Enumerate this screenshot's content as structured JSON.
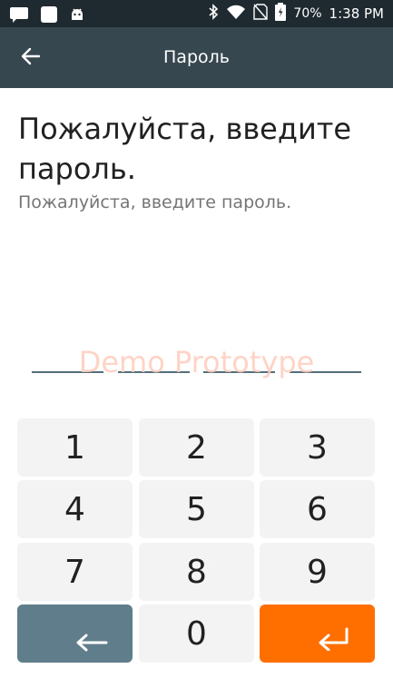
{
  "status_bar": {
    "icons_left": [
      "message-icon",
      "square-icon",
      "android-icon"
    ],
    "icons_right": [
      "bluetooth-icon",
      "wifi-icon",
      "no-sim-icon",
      "battery-icon"
    ],
    "battery": "70%",
    "time": "1:38 PM"
  },
  "app_bar": {
    "title": "Пароль",
    "back_icon": "arrow-left-icon"
  },
  "content": {
    "heading": "Пожалуйста, введите пароль.",
    "subheading": "Пожалуйста, введите пароль.",
    "pin_length": 4,
    "watermark": "Demo Prototype"
  },
  "keypad": {
    "keys": [
      "1",
      "2",
      "3",
      "4",
      "5",
      "6",
      "7",
      "8",
      "9"
    ],
    "zero": "0",
    "backspace_icon": "backspace-arrow-icon",
    "enter_icon": "enter-icon"
  },
  "colors": {
    "status_bar": "#1f2a30",
    "app_bar": "#37474f",
    "backspace_key": "#607d8b",
    "enter_key": "#ff6f00",
    "key": "#f3f3f3"
  }
}
